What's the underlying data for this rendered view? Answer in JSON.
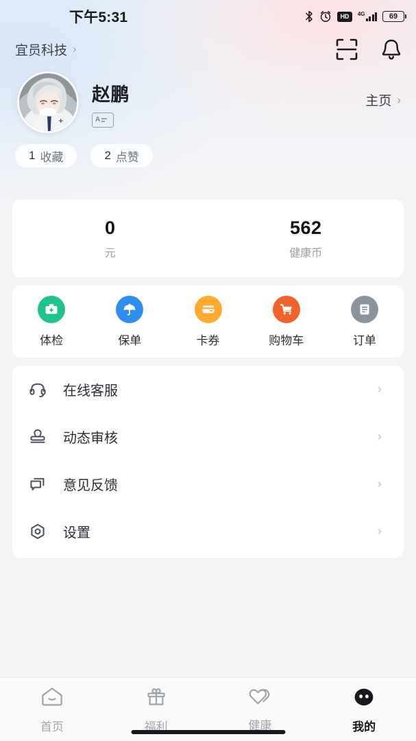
{
  "status_bar": {
    "time": "下午5:31",
    "battery_level": "69",
    "network": "4G",
    "hd_label": "HD",
    "icons": [
      "bluetooth-icon",
      "alarm-icon",
      "hd-icon",
      "signal-icon",
      "battery-icon"
    ]
  },
  "top_nav": {
    "brand": "宜员科技",
    "brand_chevron": "›",
    "scan_icon": "scan-icon",
    "bell_icon": "bell-icon"
  },
  "profile": {
    "name": "赵鹏",
    "badge_letter": "A",
    "homepage_label": "主页",
    "homepage_chevron": "›",
    "chips": [
      {
        "count": "1",
        "label": "收藏"
      },
      {
        "count": "2",
        "label": "点赞"
      }
    ]
  },
  "balance": {
    "items": [
      {
        "value": "0",
        "label": "元"
      },
      {
        "value": "562",
        "label": "健康币"
      }
    ]
  },
  "quick_actions": {
    "items": [
      {
        "label": "体检",
        "icon": "medical-kit-icon",
        "color": "#1ec48c"
      },
      {
        "label": "保单",
        "icon": "umbrella-icon",
        "color": "#2e8ef0"
      },
      {
        "label": "卡券",
        "icon": "card-icon",
        "color": "#ffa92e"
      },
      {
        "label": "购物车",
        "icon": "shopping-cart-icon",
        "color": "#f2632a"
      },
      {
        "label": "订单",
        "icon": "order-document-icon",
        "color": "#8b949c"
      }
    ]
  },
  "menu": {
    "items": [
      {
        "label": "在线客服",
        "icon": "headset-icon",
        "chevron": "›"
      },
      {
        "label": "动态审核",
        "icon": "stamp-icon",
        "chevron": "›"
      },
      {
        "label": "意见反馈",
        "icon": "feedback-message-icon",
        "chevron": "›"
      },
      {
        "label": "设置",
        "icon": "settings-hexagon-icon",
        "chevron": "›"
      }
    ]
  },
  "tabbar": {
    "items": [
      {
        "label": "首页",
        "icon": "home-icon",
        "active": false
      },
      {
        "label": "福利",
        "icon": "gift-icon",
        "active": false
      },
      {
        "label": "健康",
        "icon": "double-heart-icon",
        "active": false
      },
      {
        "label": "我的",
        "icon": "profile-face-icon",
        "active": true
      }
    ]
  },
  "theme": {
    "page_bg": "#f4f4f6",
    "card_bg": "#ffffff",
    "text_primary": "#2b2f35",
    "text_muted": "#9aa0a7",
    "chevron": "#c2c6cb"
  }
}
